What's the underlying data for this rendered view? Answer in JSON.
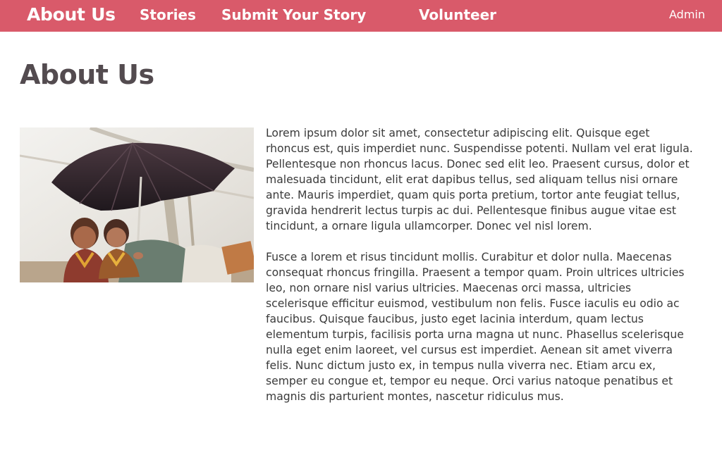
{
  "nav": {
    "home_label": "About Us",
    "stories_label": "Stories",
    "submit_label": "Submit Your Story",
    "volunteer_label": "Volunteer",
    "admin_label": "Admin"
  },
  "colors": {
    "nav_background": "#d95a6a",
    "nav_text": "#ffffff",
    "heading_text": "#534b4f",
    "body_text": "#3a3a3a"
  },
  "page": {
    "title": "About Us",
    "paragraphs": [
      "Lorem ipsum dolor sit amet, consectetur adipiscing elit. Quisque eget rhoncus est, quis imperdiet nunc. Suspendisse potenti. Nullam vel erat ligula. Pellentesque non rhoncus lacus. Donec sed elit leo. Praesent cursus, dolor et malesuada tincidunt, elit erat dapibus tellus, sed aliquam tellus nisi ornare ante. Mauris imperdiet, quam quis porta pretium, tortor ante feugiat tellus, gravida hendrerit lectus turpis ac dui. Pellentesque finibus augue vitae est tincidunt, a ornare ligula ullamcorper. Donec vel nisl lorem.",
      "Fusce a lorem et risus tincidunt mollis. Curabitur et dolor nulla. Maecenas consequat rhoncus fringilla. Praesent a tempor quam. Proin ultrices ultricies leo, non ornare nisl varius ultricies. Maecenas orci massa, ultricies scelerisque efficitur euismod, vestibulum non felis. Fusce iaculis eu odio ac faucibus. Quisque faucibus, justo eget lacinia interdum, quam lectus elementum turpis, facilisis porta urna magna ut nunc. Phasellus scelerisque nulla eget enim laoreet, vel cursus est imperdiet. Aenean sit amet viverra felis. Nunc dictum justo ex, in tempus nulla viverra nec. Etiam arcu ex, semper eu congue et, tempor eu neque. Orci varius natoque penatibus et magnis dis parturient montes, nascetur ridiculus mus."
    ]
  }
}
